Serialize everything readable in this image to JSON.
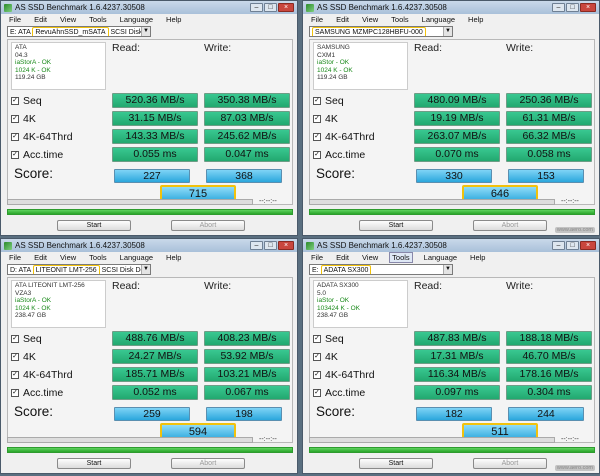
{
  "windows": [
    {
      "title": "AS SSD Benchmark 1.6.4237.30508",
      "menu": [
        "File",
        "Edit",
        "View",
        "Tools",
        "Language",
        "Help"
      ],
      "active_menu": "",
      "device_prefix": "E: ATA",
      "device_highlight": "RevuAhnSSD_mSATA",
      "device_suffix": "SCSI Disk Devi",
      "info": [
        "ATA",
        "04.3",
        "iaStorA - OK",
        "1024 K - OK",
        "119.24 GB"
      ],
      "read_label": "Read:",
      "write_label": "Write:",
      "tests": [
        {
          "name": "Seq",
          "read": "520.36 MB/s",
          "write": "350.38 MB/s"
        },
        {
          "name": "4K",
          "read": "31.15 MB/s",
          "write": "87.03 MB/s"
        },
        {
          "name": "4K-64Thrd",
          "read": "143.33 MB/s",
          "write": "245.62 MB/s"
        },
        {
          "name": "Acc.time",
          "read": "0.055 ms",
          "write": "0.047 ms"
        }
      ],
      "score_label": "Score:",
      "score_read": "227",
      "score_write": "368",
      "score_total": "715",
      "timer": "--:--:--",
      "start": "Start",
      "abort": "Abort",
      "watermark": ""
    },
    {
      "title": "AS SSD Benchmark 1.6.4237.30508",
      "menu": [
        "File",
        "Edit",
        "View",
        "Tools",
        "Language",
        "Help"
      ],
      "active_menu": "",
      "device_prefix": "",
      "device_highlight": "SAMSUNG MZMPC128HBFU-000",
      "device_suffix": "",
      "info": [
        "SAMSUNG",
        "CXM1",
        "iaStor - OK",
        "1024 K - OK",
        "119.24 GB"
      ],
      "read_label": "Read:",
      "write_label": "Write:",
      "tests": [
        {
          "name": "Seq",
          "read": "480.09 MB/s",
          "write": "250.36 MB/s"
        },
        {
          "name": "4K",
          "read": "19.19 MB/s",
          "write": "61.31 MB/s"
        },
        {
          "name": "4K-64Thrd",
          "read": "263.07 MB/s",
          "write": "66.32 MB/s"
        },
        {
          "name": "Acc.time",
          "read": "0.070 ms",
          "write": "0.058 ms"
        }
      ],
      "score_label": "Score:",
      "score_read": "330",
      "score_write": "153",
      "score_total": "646",
      "timer": "--:--:--",
      "start": "Start",
      "abort": "Abort",
      "watermark": "www.aero.com"
    },
    {
      "title": "AS SSD Benchmark 1.6.4237.30508",
      "menu": [
        "File",
        "Edit",
        "View",
        "Tools",
        "Language",
        "Help"
      ],
      "active_menu": "",
      "device_prefix": "D: ATA",
      "device_highlight": "LITEONIT LMT-256",
      "device_suffix": "SCSI Disk Device",
      "info": [
        "ATA LITEONIT LMT-256",
        "VZA3",
        "iaStorA - OK",
        "1024 K - OK",
        "238.47 GB"
      ],
      "read_label": "Read:",
      "write_label": "Write:",
      "tests": [
        {
          "name": "Seq",
          "read": "488.76 MB/s",
          "write": "408.23 MB/s"
        },
        {
          "name": "4K",
          "read": "24.27 MB/s",
          "write": "53.92 MB/s"
        },
        {
          "name": "4K-64Thrd",
          "read": "185.71 MB/s",
          "write": "103.21 MB/s"
        },
        {
          "name": "Acc.time",
          "read": "0.052 ms",
          "write": "0.067 ms"
        }
      ],
      "score_label": "Score:",
      "score_read": "259",
      "score_write": "198",
      "score_total": "594",
      "timer": "--:--:--",
      "start": "Start",
      "abort": "Abort",
      "watermark": ""
    },
    {
      "title": "AS SSD Benchmark 1.6.4237.30508",
      "menu": [
        "File",
        "Edit",
        "View",
        "Tools",
        "Language",
        "Help"
      ],
      "active_menu": "Tools",
      "device_prefix": "E:",
      "device_highlight": "ADATA SX300",
      "device_suffix": "",
      "info": [
        "ADATA SX300",
        "5.0",
        "iaStor - OK",
        "103424 K - OK",
        "238.47 GB"
      ],
      "read_label": "Read:",
      "write_label": "Write:",
      "tests": [
        {
          "name": "Seq",
          "read": "487.83 MB/s",
          "write": "188.18 MB/s"
        },
        {
          "name": "4K",
          "read": "17.31 MB/s",
          "write": "46.70 MB/s"
        },
        {
          "name": "4K-64Thrd",
          "read": "116.34 MB/s",
          "write": "178.16 MB/s"
        },
        {
          "name": "Acc.time",
          "read": "0.097 ms",
          "write": "0.304 ms"
        }
      ],
      "score_label": "Score:",
      "score_read": "182",
      "score_write": "244",
      "score_total": "511",
      "timer": "--:--:--",
      "start": "Start",
      "abort": "Abort",
      "watermark": "www.aero.com"
    }
  ]
}
